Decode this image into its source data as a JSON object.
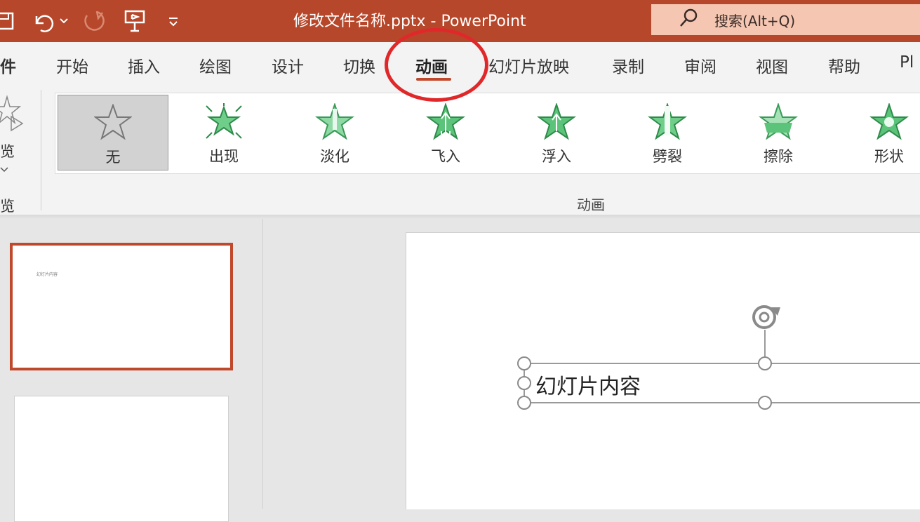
{
  "window": {
    "title": "修改文件名称.pptx  -  PowerPoint",
    "search_placeholder": "搜索(Alt+Q)"
  },
  "qat": {
    "icons": [
      "save-icon",
      "undo-icon",
      "redo-icon",
      "present-icon",
      "customize-icon"
    ]
  },
  "tabs": [
    {
      "label": "件"
    },
    {
      "label": "开始"
    },
    {
      "label": "插入"
    },
    {
      "label": "绘图"
    },
    {
      "label": "设计"
    },
    {
      "label": "切换"
    },
    {
      "label": "动画",
      "active": true
    },
    {
      "label": "幻灯片放映"
    },
    {
      "label": "录制"
    },
    {
      "label": "审阅"
    },
    {
      "label": "视图"
    },
    {
      "label": "帮助"
    },
    {
      "label": "Pl"
    }
  ],
  "preview": {
    "button_label": "览",
    "group_label": "览"
  },
  "animations": {
    "group_label": "动画",
    "items": [
      {
        "label": "无",
        "selected": true
      },
      {
        "label": "出现"
      },
      {
        "label": "淡化"
      },
      {
        "label": "飞入"
      },
      {
        "label": "浮入"
      },
      {
        "label": "劈裂"
      },
      {
        "label": "擦除"
      },
      {
        "label": "形状"
      }
    ]
  },
  "thumbnails": {
    "slide1_tiny_text": "幻灯片内容"
  },
  "slide": {
    "text": "幻灯片内容"
  },
  "colors": {
    "accent": "#b7472a",
    "highlight_circle": "#e0282a",
    "star_green": "#4cbb6c"
  }
}
